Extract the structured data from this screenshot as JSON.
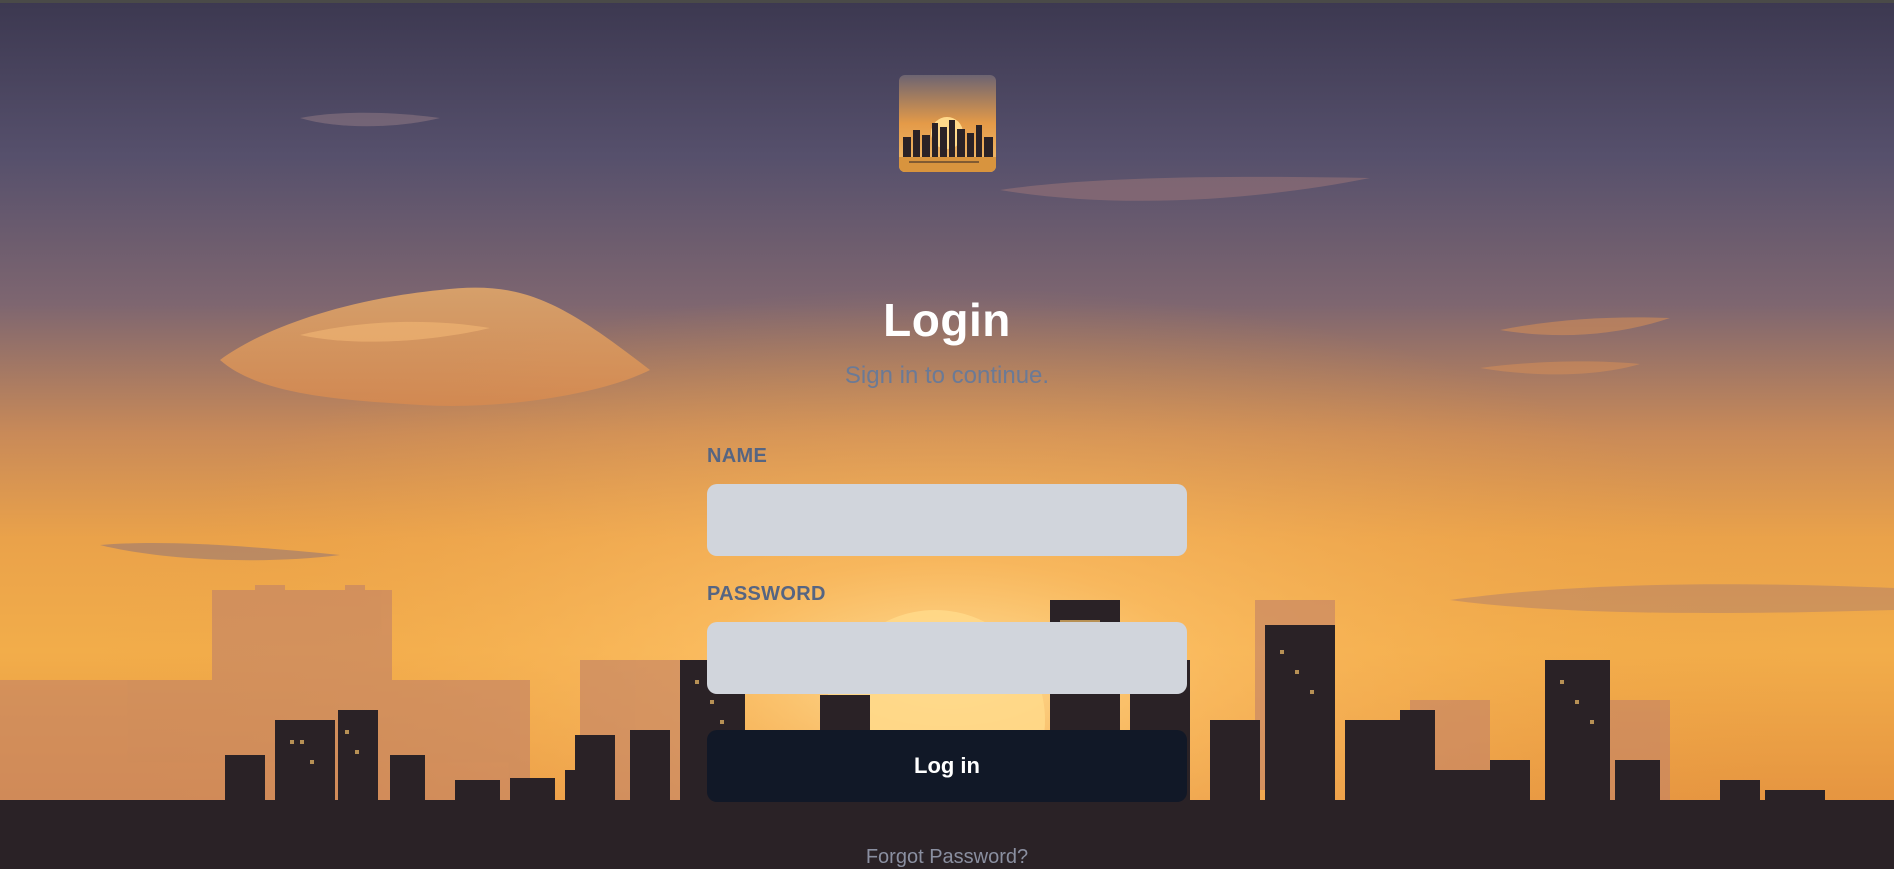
{
  "login": {
    "title": "Login",
    "subtitle": "Sign in to continue.",
    "name_label": "NAME",
    "name_value": "",
    "password_label": "PASSWORD",
    "password_value": "",
    "submit_label": "Log in",
    "forgot_label": "Forgot Password?"
  },
  "background": {
    "icon": "city-skyline-sunset-image"
  },
  "logo": {
    "icon": "city-skyline-logo-icon"
  },
  "colors": {
    "sky_top": "#3c3850",
    "sky_horizon": "#f1a53e",
    "sun": "#ffd27a",
    "button": "#111827",
    "input": "#d1d5dc",
    "label": "#566582",
    "subtitle": "#6b7a96"
  }
}
